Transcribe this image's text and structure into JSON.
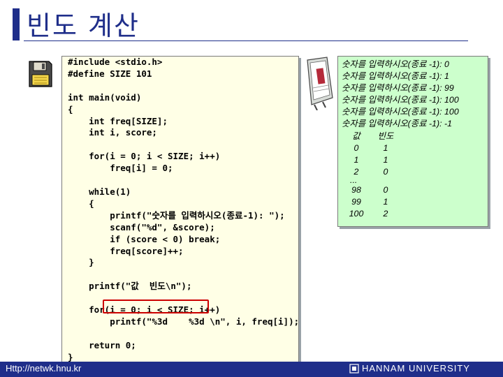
{
  "slide": {
    "title": "빈도 계산",
    "colors": {
      "accent": "#1f2e8a",
      "code_bg": "#ffffe6",
      "output_bg": "#ccffcc",
      "highlight": "#cc0000"
    }
  },
  "code": {
    "lines": [
      "#include <stdio.h>",
      "#define SIZE 101",
      "",
      "int main(void)",
      "{",
      "    int freq[SIZE];",
      "    int i, score;",
      "",
      "    for(i = 0; i < SIZE; i++)",
      "        freq[i] = 0;",
      "",
      "    while(1)",
      "    {",
      "        printf(\"숫자를 입력하시오(종료-1): \");",
      "        scanf(\"%d\", &score);",
      "        if (score < 0) break;",
      "        freq[score]++;",
      "    }",
      "",
      "    printf(\"값  빈도\\n\");",
      "",
      "    for(i = 0; i < SIZE; i++)",
      "        printf(\"%3d    %3d \\n\", i, freq[i]);",
      "",
      "    return 0;",
      "}"
    ],
    "highlighted_line": "freq[score]++;"
  },
  "output": {
    "prompts": [
      "숫자를 입력하시오(종료 -1): 0",
      "숫자를 입력하시오(종료 -1): 1",
      "숫자를 입력하시오(종료 -1): 99",
      "숫자를 입력하시오(종료 -1): 100",
      "숫자를 입력하시오(종료 -1): 100",
      "숫자를 입력하시오(종료 -1): -1"
    ],
    "header": {
      "value": "값",
      "frequency": "빈도"
    },
    "rows_top": [
      {
        "value": "0",
        "freq": "1"
      },
      {
        "value": "1",
        "freq": "1"
      },
      {
        "value": "2",
        "freq": "0"
      }
    ],
    "ellipsis": "...",
    "rows_bottom": [
      {
        "value": "98",
        "freq": "0"
      },
      {
        "value": "99",
        "freq": "1"
      },
      {
        "value": "100",
        "freq": "2"
      }
    ]
  },
  "footer": {
    "url": "Http://netwk.hnu.kr",
    "university": "HANNAM UNIVERSITY"
  },
  "icons": {
    "left": "floppy-disk-icon",
    "right": "notepad-icon"
  }
}
